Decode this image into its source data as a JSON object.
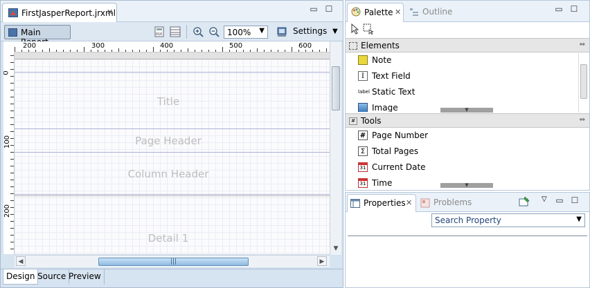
{
  "editor": {
    "tab_title": "FirstJasperReport.jrxml",
    "toolbar": {
      "main_report_label": "Main Report",
      "zoom_value": "100%",
      "settings_label": "Settings"
    },
    "ruler_h_labels": [
      "200",
      "300",
      "400",
      "500",
      "600"
    ],
    "ruler_v_labels": [
      "0",
      "100",
      "200"
    ],
    "bands": {
      "title": "Title",
      "page_header": "Page Header",
      "column_header": "Column Header",
      "detail": "Detail 1"
    },
    "bottom_tabs": [
      "Design",
      "Source",
      "Preview"
    ],
    "active_bottom_tab": "Design"
  },
  "palette_view": {
    "tabs": [
      "Palette",
      "Outline"
    ],
    "active_tab": "Palette",
    "sections": [
      {
        "title": "Elements",
        "items": [
          {
            "label": "Note",
            "icon": "note-icon"
          },
          {
            "label": "Text Field",
            "icon": "text-field-icon"
          },
          {
            "label": "Static Text",
            "icon": "static-text-icon"
          },
          {
            "label": "Image",
            "icon": "image-icon"
          }
        ]
      },
      {
        "title": "Tools",
        "items": [
          {
            "label": "Page Number",
            "icon": "hash-icon"
          },
          {
            "label": "Total Pages",
            "icon": "sigma-icon"
          },
          {
            "label": "Current Date",
            "icon": "calendar-icon"
          },
          {
            "label": "Time",
            "icon": "calendar-icon"
          }
        ]
      }
    ]
  },
  "properties_view": {
    "tabs": [
      "Properties",
      "Problems"
    ],
    "active_tab": "Properties",
    "search_placeholder": "Search Property"
  },
  "colors": {
    "editor_chrome": "#d6e3f0",
    "band_line": "#aeb2d6",
    "band_label": "#bdbdbd",
    "scroll_thumb": "#8fbbe0"
  }
}
